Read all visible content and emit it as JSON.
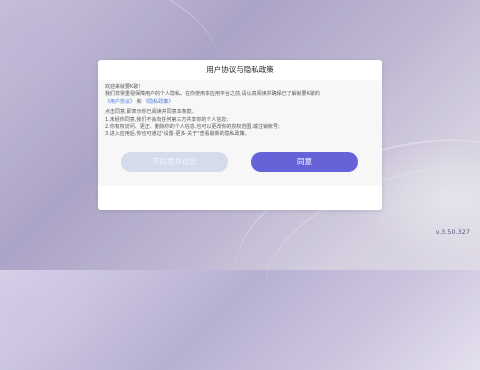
{
  "dialog": {
    "title": "用户协议与隐私政策",
    "greeting": "欢迎来就要K歌!",
    "intro": "我们非常重视保障用户的个人隐私。在你使用本应用平台之前,请认真阅读并确保已了解就要K歌的",
    "user_agreement_link": "《用户协议》",
    "and_text": " 和 ",
    "privacy_policy_link": "《隐私政策》",
    "consent_note": "点击同意,即表示你已阅读并同意本条款。",
    "items": [
      "1.未经你同意,我们不会向任何第三方共享你的个人信息;",
      "2.你有权访问、更正、删除你的个人信息,也可以更改你的授权范围,或注销帐号;",
      "3.进入应用后,你也可通过\"设置-更多-关于\"查看最新的隐私政策。"
    ],
    "decline_label": "不同意并退出",
    "agree_label": "同意"
  },
  "version": "v.3.50.327",
  "colors": {
    "accent": "#6563d7",
    "link": "#4a7bd6",
    "decline_button": "#d5dbeb"
  }
}
